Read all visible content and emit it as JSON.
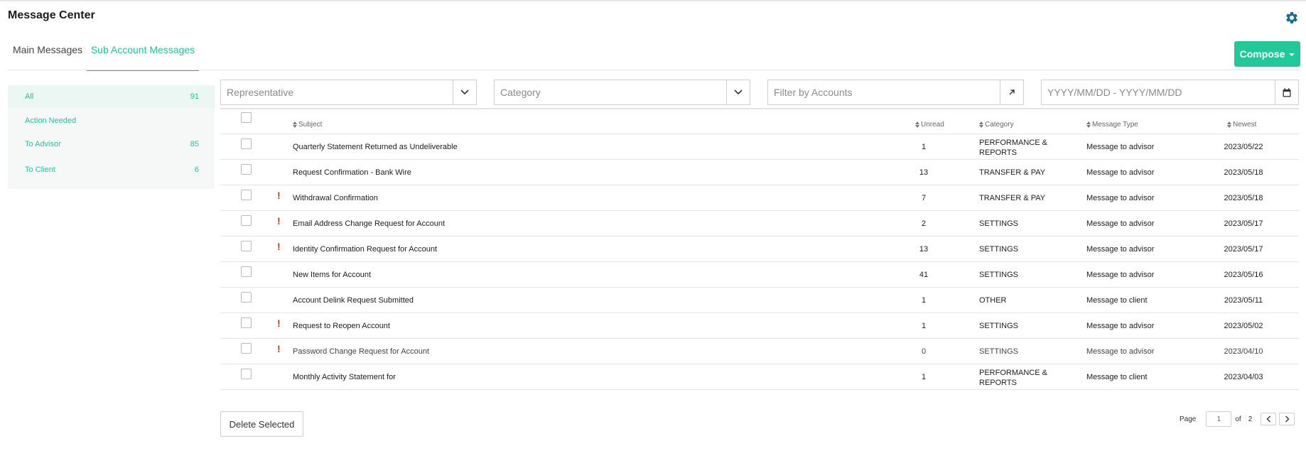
{
  "header": {
    "title": "Message Center",
    "settings_icon": "gear-icon"
  },
  "tabs": [
    {
      "label": "Main Messages",
      "active": false
    },
    {
      "label": "Sub Account Messages",
      "active": true
    }
  ],
  "compose": {
    "label": "Compose"
  },
  "sidebar": {
    "items": [
      {
        "label": "All",
        "count": "91",
        "active": true
      },
      {
        "label": "Action Needed",
        "count": ""
      },
      {
        "label": "To Advisor",
        "count": "85"
      },
      {
        "label": "To Client",
        "count": "6"
      }
    ]
  },
  "filters": {
    "representative": {
      "placeholder": "Representative",
      "icon": "chevron-down-icon"
    },
    "category": {
      "placeholder": "Category",
      "icon": "chevron-down-icon"
    },
    "accounts": {
      "placeholder": "Filter by Accounts",
      "icon": "external-arrow-icon"
    },
    "dates": {
      "placeholder": "YYYY/MM/DD - YYYY/MM/DD",
      "icon": "calendar-icon"
    }
  },
  "table": {
    "columns": {
      "subject": "Subject",
      "unread": "Unread",
      "category": "Category",
      "type": "Message Type",
      "newest": "Newest"
    },
    "rows": [
      {
        "flag": "",
        "subject": "Quarterly Statement Returned as Undeliverable",
        "unread": "1",
        "category": "PERFORMANCE & REPORTS",
        "type": "Message to advisor",
        "newest": "2023/05/22"
      },
      {
        "flag": "",
        "subject": "Request Confirmation - Bank Wire",
        "unread": "13",
        "category": "TRANSFER & PAY",
        "type": "Message to advisor",
        "newest": "2023/05/18"
      },
      {
        "flag": "!",
        "subject": "Withdrawal Confirmation",
        "unread": "7",
        "category": "TRANSFER & PAY",
        "type": "Message to advisor",
        "newest": "2023/05/18"
      },
      {
        "flag": "!",
        "subject": "Email Address Change Request for Account",
        "unread": "2",
        "category": "SETTINGS",
        "type": "Message to advisor",
        "newest": "2023/05/17"
      },
      {
        "flag": "!",
        "subject": "Identity Confirmation Request for Account",
        "unread": "13",
        "category": "SETTINGS",
        "type": "Message to advisor",
        "newest": "2023/05/17"
      },
      {
        "flag": "",
        "subject": "New Items for Account",
        "unread": "41",
        "category": "SETTINGS",
        "type": "Message to advisor",
        "newest": "2023/05/16"
      },
      {
        "flag": "",
        "subject": "Account Delink Request Submitted",
        "unread": "1",
        "category": "OTHER",
        "type": "Message to client",
        "newest": "2023/05/11"
      },
      {
        "flag": "!",
        "subject": "Request to Reopen Account",
        "unread": "1",
        "category": "SETTINGS",
        "type": "Message to advisor",
        "newest": "2023/05/02"
      },
      {
        "flag": "!",
        "subject": "Password Change Request for Account",
        "unread": "0",
        "category": "SETTINGS",
        "type": "Message to advisor",
        "newest": "2023/04/10"
      },
      {
        "flag": "",
        "subject": "Monthly Activity Statement for",
        "unread": "1",
        "category": "PERFORMANCE & REPORTS",
        "type": "Message to client",
        "newest": "2023/04/03"
      }
    ]
  },
  "footer": {
    "delete_label": "Delete Selected",
    "page_label": "Page",
    "page_value": "1",
    "of_label": "of",
    "total_pages": "2"
  }
}
